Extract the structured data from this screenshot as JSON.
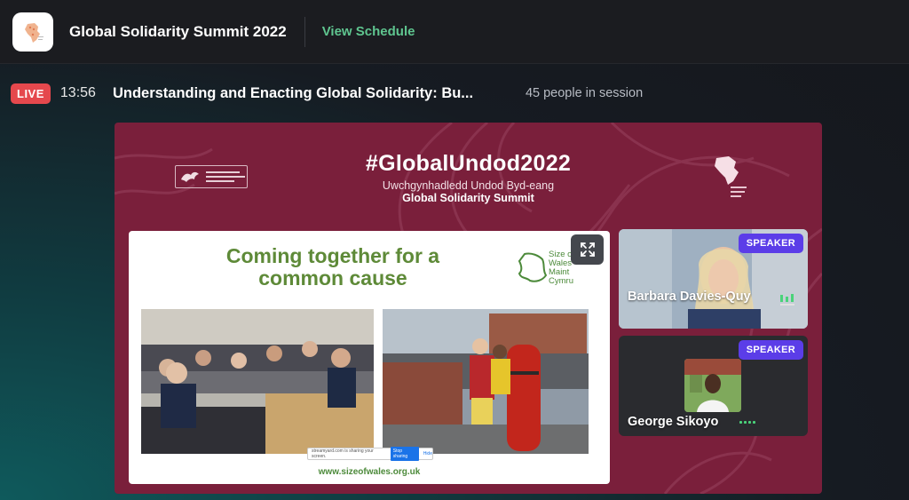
{
  "header": {
    "event_title": "Global Solidarity Summit 2022",
    "view_schedule_label": "View Schedule"
  },
  "session": {
    "live_label": "LIVE",
    "elapsed": "13:56",
    "title": "Understanding and Enacting Global Solidarity: Bu...",
    "people_count": "45 people in session"
  },
  "stage": {
    "hashtag": "#GlobalUndod2022",
    "subtitle_welsh": "Uwchgynhadledd Undod Byd-eang",
    "subtitle_english": "Global Solidarity Summit",
    "hub_logo_text": "Hub Cymru Africa"
  },
  "slide": {
    "title_line1": "Coming together for a",
    "title_line2": "common cause",
    "logo_text_line1": "Size of",
    "logo_text_line2": "Wales",
    "logo_text_line3": "Maint",
    "logo_text_line4": "Cymru",
    "url": "www.sizeofwales.org.uk",
    "share_bar_text": "streamyard.com is sharing your screen.",
    "share_stop_label": "Stop sharing",
    "share_hide_label": "Hide"
  },
  "speakers": [
    {
      "badge": "SPEAKER",
      "name": "Barbara Davies-Quy"
    },
    {
      "badge": "SPEAKER",
      "name": "George Sikoyo"
    }
  ],
  "colors": {
    "live": "#e5484d",
    "schedule_link": "#5fc58f",
    "stage_bg": "#7a1f3b",
    "speaker_badge": "#5b3de8",
    "slide_green": "#5e8a38"
  }
}
